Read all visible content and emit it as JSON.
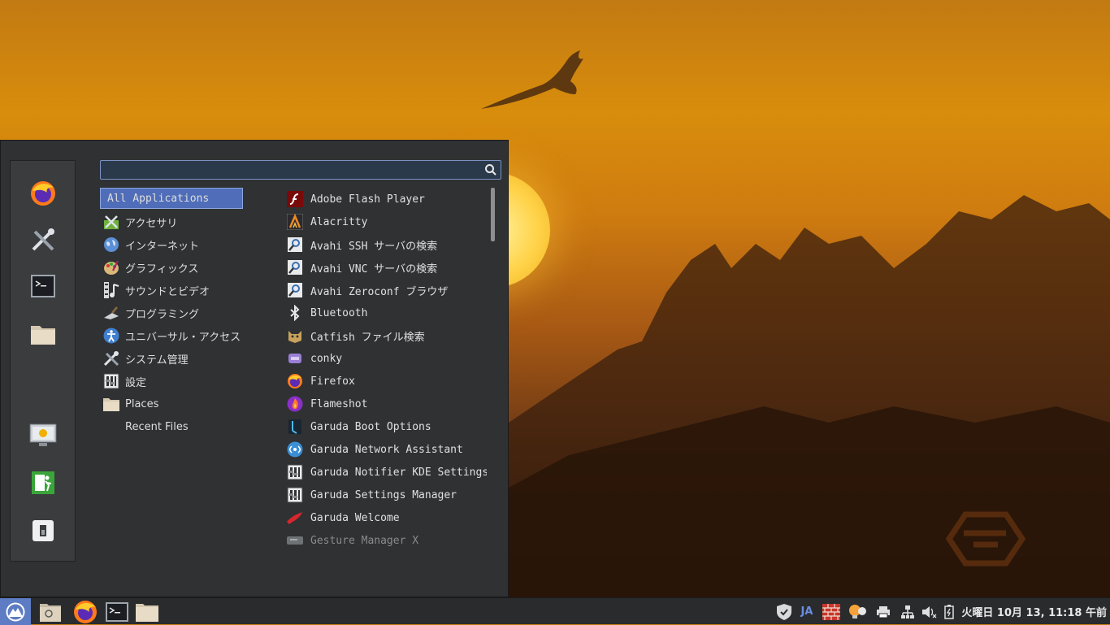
{
  "search": {
    "value": "",
    "placeholder": ""
  },
  "categories": [
    {
      "label": "All Applications",
      "icon": "none",
      "selected": true
    },
    {
      "label": "アクセサリ",
      "icon": "accessories-icon"
    },
    {
      "label": "インターネット",
      "icon": "internet-globe-icon"
    },
    {
      "label": "グラフィックス",
      "icon": "graphics-palette-icon"
    },
    {
      "label": "サウンドとビデオ",
      "icon": "multimedia-icon"
    },
    {
      "label": "プログラミング",
      "icon": "programming-trowel-icon"
    },
    {
      "label": "ユニバーサル・アクセス",
      "icon": "accessibility-icon"
    },
    {
      "label": "システム管理",
      "icon": "system-tools-icon"
    },
    {
      "label": "設定",
      "icon": "settings-icon"
    },
    {
      "label": "Places",
      "icon": "folder-icon"
    },
    {
      "label": "Recent Files",
      "icon": "none"
    }
  ],
  "apps": [
    {
      "label": "Adobe Flash Player",
      "icon": "flash-player-icon"
    },
    {
      "label": "Alacritty",
      "icon": "alacritty-icon"
    },
    {
      "label": "Avahi SSH サーバの検索",
      "icon": "avahi-search-icon"
    },
    {
      "label": "Avahi VNC サーバの検索",
      "icon": "avahi-search-icon"
    },
    {
      "label": "Avahi Zeroconf ブラウザ",
      "icon": "avahi-search-icon"
    },
    {
      "label": "Bluetooth",
      "icon": "bluetooth-icon"
    },
    {
      "label": "Catfish ファイル検索",
      "icon": "catfish-icon"
    },
    {
      "label": "conky",
      "icon": "conky-icon"
    },
    {
      "label": "Firefox",
      "icon": "firefox-icon"
    },
    {
      "label": "Flameshot",
      "icon": "flameshot-icon"
    },
    {
      "label": "Garuda Boot Options",
      "icon": "garuda-boot-icon"
    },
    {
      "label": "Garuda Network Assistant",
      "icon": "network-assistant-icon"
    },
    {
      "label": "Garuda Notifier KDE Settings",
      "icon": "settings-icon"
    },
    {
      "label": "Garuda Settings Manager",
      "icon": "settings-icon"
    },
    {
      "label": "Garuda Welcome",
      "icon": "garuda-welcome-icon"
    },
    {
      "label": "Gesture Manager X",
      "icon": "gesture-icon",
      "dim": true
    }
  ],
  "favorites": [
    "firefox-icon",
    "tools-icon",
    "terminal-icon",
    "folder-icon"
  ],
  "session_buttons": [
    "lock-screen-icon",
    "logout-icon",
    "switch-user-icon"
  ],
  "taskbar": [
    "garuda-menu-icon",
    "file-search-icon",
    "firefox-icon",
    "terminal-icon",
    "folder-icon"
  ],
  "tray": {
    "ja_label": "JA",
    "icons": [
      "shield-icon",
      "firewall-icon",
      "notification-bulb-icon",
      "printer-icon",
      "network-icon",
      "volume-muted-icon",
      "battery-icon"
    ]
  },
  "clock": "火曜日 10月 13, 11:18 午前",
  "colors": {
    "accent": "#4f6db8",
    "panel": "#2a2b2d",
    "menu_bg": "#2f3133"
  }
}
